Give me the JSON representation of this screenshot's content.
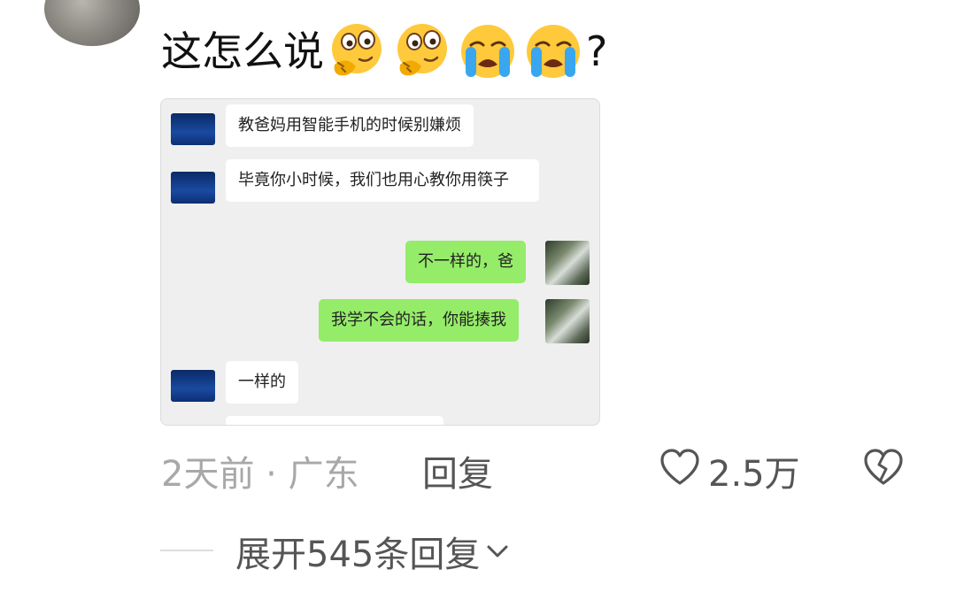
{
  "comment": {
    "text": "这怎么说",
    "emojis": [
      "thinking-hand-on-chin-emoji",
      "thinking-hand-on-chin-emoji",
      "loudly-crying-emoji",
      "loudly-crying-emoji"
    ],
    "trailing": "?"
  },
  "screenshot": {
    "messages": [
      {
        "side": "left",
        "text": "教爸妈用智能手机的时候别嫌烦"
      },
      {
        "side": "left",
        "text": "毕竟你小时候，我们也用心教你用筷子"
      },
      {
        "side": "right",
        "text": "不一样的，爸"
      },
      {
        "side": "right",
        "text": "我学不会的话，你能揍我"
      },
      {
        "side": "left",
        "text": "一样的"
      }
    ]
  },
  "meta": {
    "time_location": "2天前 · 广东",
    "reply_label": "回复",
    "like_count": "2.5万",
    "like_icon": "heart-outline-icon",
    "dislike_icon": "broken-heart-icon"
  },
  "expand": {
    "label": "展开545条回复",
    "icon": "chevron-down-icon"
  },
  "colors": {
    "bubble_right": "#95ec69",
    "bubble_left": "#ffffff",
    "chat_bg": "#efefef",
    "muted_text": "#a8a8a8"
  }
}
